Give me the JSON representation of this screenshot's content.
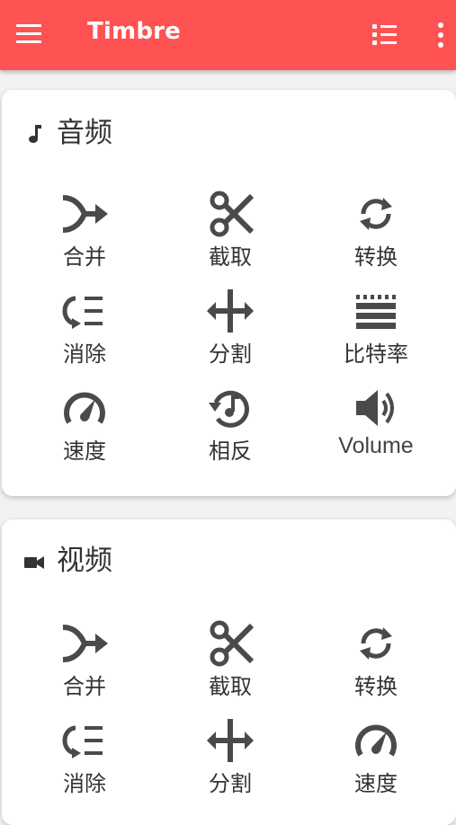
{
  "app": {
    "title": "Timbre"
  },
  "toolbar": {
    "menu_icon": "hamburger-menu-icon",
    "list_icon": "checklist-icon",
    "more_icon": "more-vertical-icon"
  },
  "colors": {
    "accent": "#ff5252",
    "icon": "#4a4a4a",
    "text": "#333333",
    "card": "#ffffff",
    "background": "#f2f2f2"
  },
  "audio": {
    "title": "音频",
    "icon": "music-note-icon",
    "tools": [
      {
        "label": "合并",
        "icon": "merge-icon"
      },
      {
        "label": "截取",
        "icon": "scissors-icon"
      },
      {
        "label": "转换",
        "icon": "convert-icon"
      },
      {
        "label": "消除",
        "icon": "remove-icon"
      },
      {
        "label": "分割",
        "icon": "split-icon"
      },
      {
        "label": "比特率",
        "icon": "bitrate-icon"
      },
      {
        "label": "速度",
        "icon": "speed-icon"
      },
      {
        "label": "相反",
        "icon": "reverse-icon"
      },
      {
        "label": "Volume",
        "icon": "volume-icon"
      }
    ]
  },
  "video": {
    "title": "视频",
    "icon": "video-camera-icon",
    "tools": [
      {
        "label": "合并",
        "icon": "merge-icon"
      },
      {
        "label": "截取",
        "icon": "scissors-icon"
      },
      {
        "label": "转换",
        "icon": "convert-icon"
      },
      {
        "label": "消除",
        "icon": "remove-icon"
      },
      {
        "label": "分割",
        "icon": "split-icon"
      },
      {
        "label": "速度",
        "icon": "speed-icon"
      }
    ]
  }
}
